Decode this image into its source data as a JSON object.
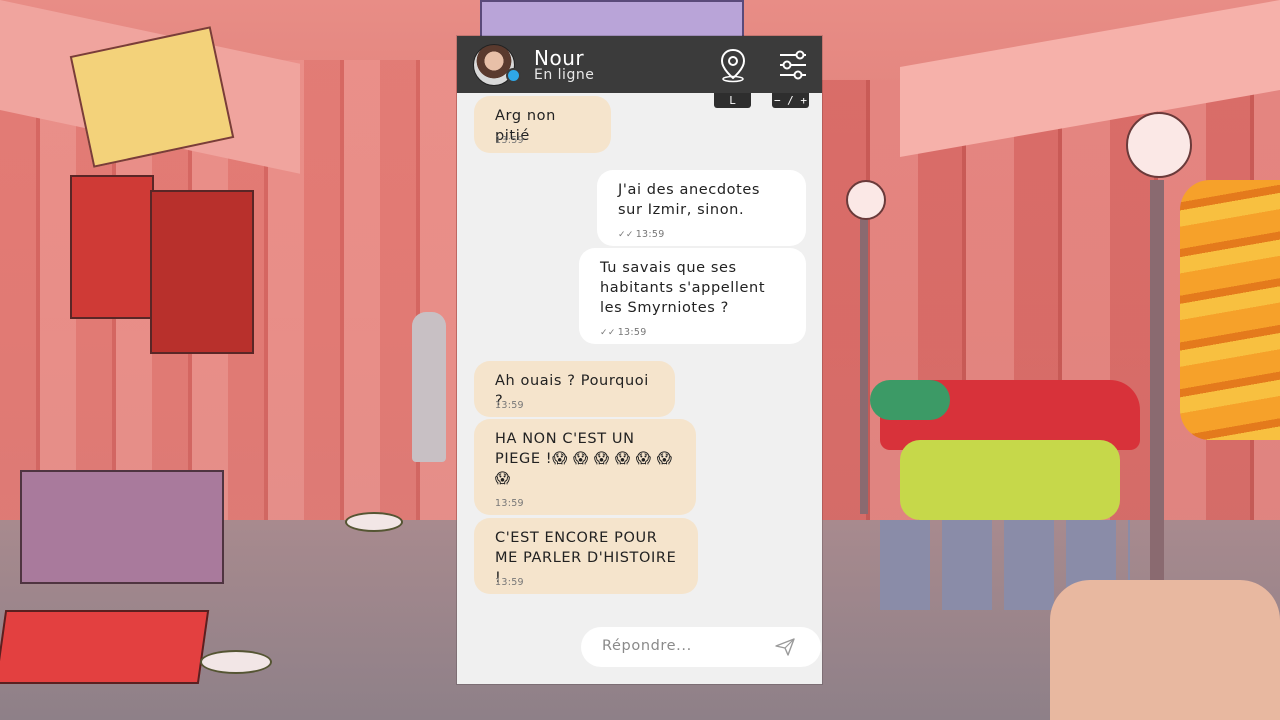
{
  "contact": {
    "name": "Nour",
    "status": "En ligne"
  },
  "hints": {
    "map_key": "L",
    "zoom_key": "− / +"
  },
  "messages": [
    {
      "dir": "in",
      "text": "Arg non pitié",
      "time": "13:59"
    },
    {
      "dir": "out",
      "text": "J'ai des anecdotes sur Izmir, sinon.",
      "time": "13:59",
      "ticks": "✓✓"
    },
    {
      "dir": "out",
      "text": "Tu savais que ses habitants s'appellent les Smyrniotes ?",
      "time": "13:59",
      "ticks": "✓✓"
    },
    {
      "dir": "in",
      "text": "Ah ouais ? Pourquoi ?",
      "time": "13:59"
    },
    {
      "dir": "in",
      "text": "HA NON C'EST UN PIEGE !😱 😱 😱 😱 😱 😱 😱",
      "time": "13:59"
    },
    {
      "dir": "in",
      "text": "C'EST ENCORE POUR ME PARLER D'HISTOIRE !",
      "time": "13:59"
    }
  ],
  "reply": {
    "placeholder": "Répondre..."
  },
  "icons": {
    "map": "map-pin-icon",
    "settings": "sliders-icon",
    "send": "paper-plane-icon"
  },
  "colors": {
    "header": "#3b3b3b",
    "incoming_bubble": "#f5e4cc",
    "outgoing_bubble": "#ffffff",
    "chat_background": "#f0f0f0",
    "online_dot": "#2fa8e8"
  }
}
